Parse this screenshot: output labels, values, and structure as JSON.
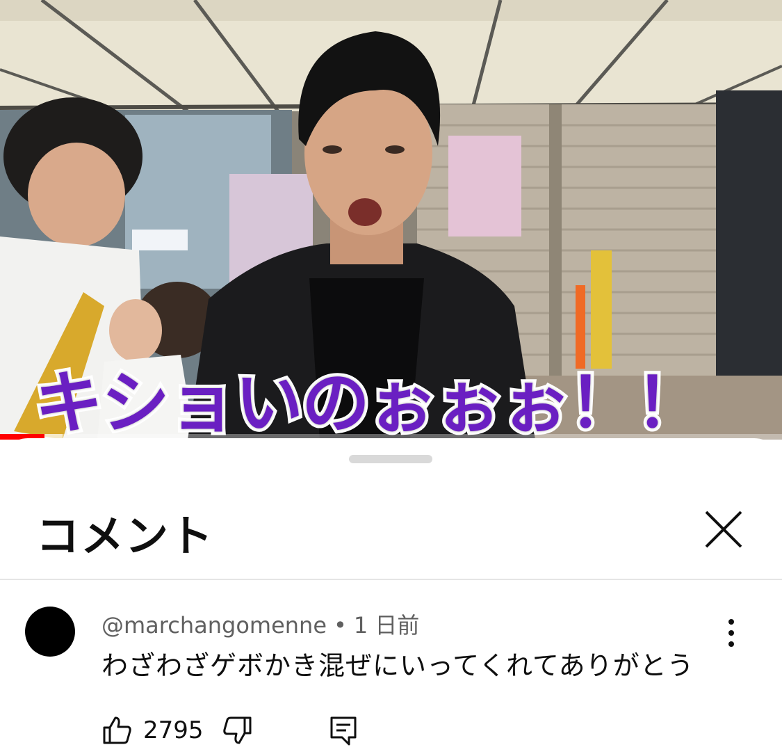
{
  "video": {
    "caption": "キショいのぉぉぉ！！",
    "progress": 0.057,
    "buffered": 0.08
  },
  "comments_panel": {
    "title": "コメント",
    "close_icon": "close-icon",
    "comments": [
      {
        "author": "@marchangomenne",
        "separator": "•",
        "time": "1 日前",
        "text": "わざわざゲボかき混ぜにいってくれてありがとう",
        "likes": "2795",
        "icons": [
          "thumbs-up-icon",
          "thumbs-down-icon",
          "reply-icon",
          "more-vert-icon"
        ]
      }
    ]
  },
  "colors": {
    "caption_fill": "#6a1fc2",
    "caption_stroke": "#ffffff",
    "progress": "#ff0000",
    "text_primary": "#0f0f0f",
    "text_secondary": "#606060"
  }
}
